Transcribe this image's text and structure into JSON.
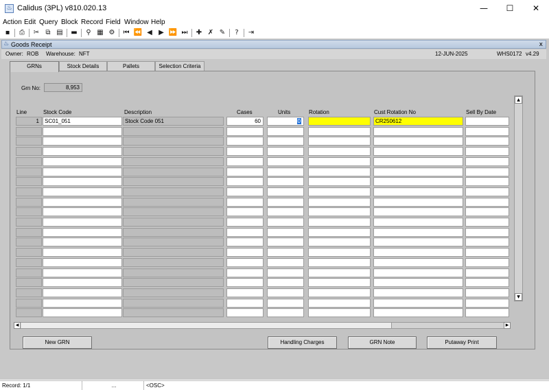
{
  "window": {
    "title": "Calidus (3PL) v810.020.13",
    "minimize": "—",
    "maximize": "☐",
    "close": "✕"
  },
  "menu": [
    "Action",
    "Edit",
    "Query",
    "Block",
    "Record",
    "Field",
    "Window",
    "Help"
  ],
  "toolbar_icons": [
    "save-icon",
    "print-icon",
    "cut-icon",
    "copy-icon",
    "paste-icon",
    "clear-icon",
    "query-icon",
    "enter-query-icon",
    "execute-query-icon",
    "first-record-icon",
    "previous-block-icon",
    "previous-record-icon",
    "next-record-icon",
    "next-block-icon",
    "last-record-icon",
    "insert-record-icon",
    "delete-record-icon",
    "clear-record-icon",
    "help-icon",
    "exit-icon"
  ],
  "form": {
    "title": "Goods Receipt",
    "close": "x",
    "owner_label": "Owner:",
    "owner": "ROB",
    "warehouse_label": "Warehouse:",
    "warehouse": "NFT",
    "date": "12-JUN-2025",
    "form_code": "WHS0172",
    "version": "v4.29"
  },
  "tabs": [
    "GRNs",
    "Stock Details",
    "Pallets",
    "Selection Criteria"
  ],
  "grn": {
    "label": "Grn No:",
    "value": "8,953"
  },
  "columns": [
    "Line",
    "Stock Code",
    "Description",
    "Cases",
    "Units",
    "Rotation",
    "Cust Rotation No",
    "Sell By Date"
  ],
  "rows": [
    {
      "line": "1",
      "stock_code": "SC01_051",
      "description": "Stock Code 051",
      "cases": "60",
      "units": "0",
      "rotation": "",
      "cust_rotation_no": "CR250612",
      "sell_by_date": ""
    }
  ],
  "empty_rows": 19,
  "buttons": {
    "new_grn": "New GRN",
    "handling_charges": "Handling Charges",
    "grn_note": "GRN Note",
    "putaway_print": "Putaway Print"
  },
  "status": {
    "record": "Record: 1/1",
    "count": "...",
    "mode": "<OSC>"
  },
  "colors": {
    "canvas": "#c3c3c3",
    "required_field": "#ffff00",
    "selection": "#1e6fd9"
  }
}
